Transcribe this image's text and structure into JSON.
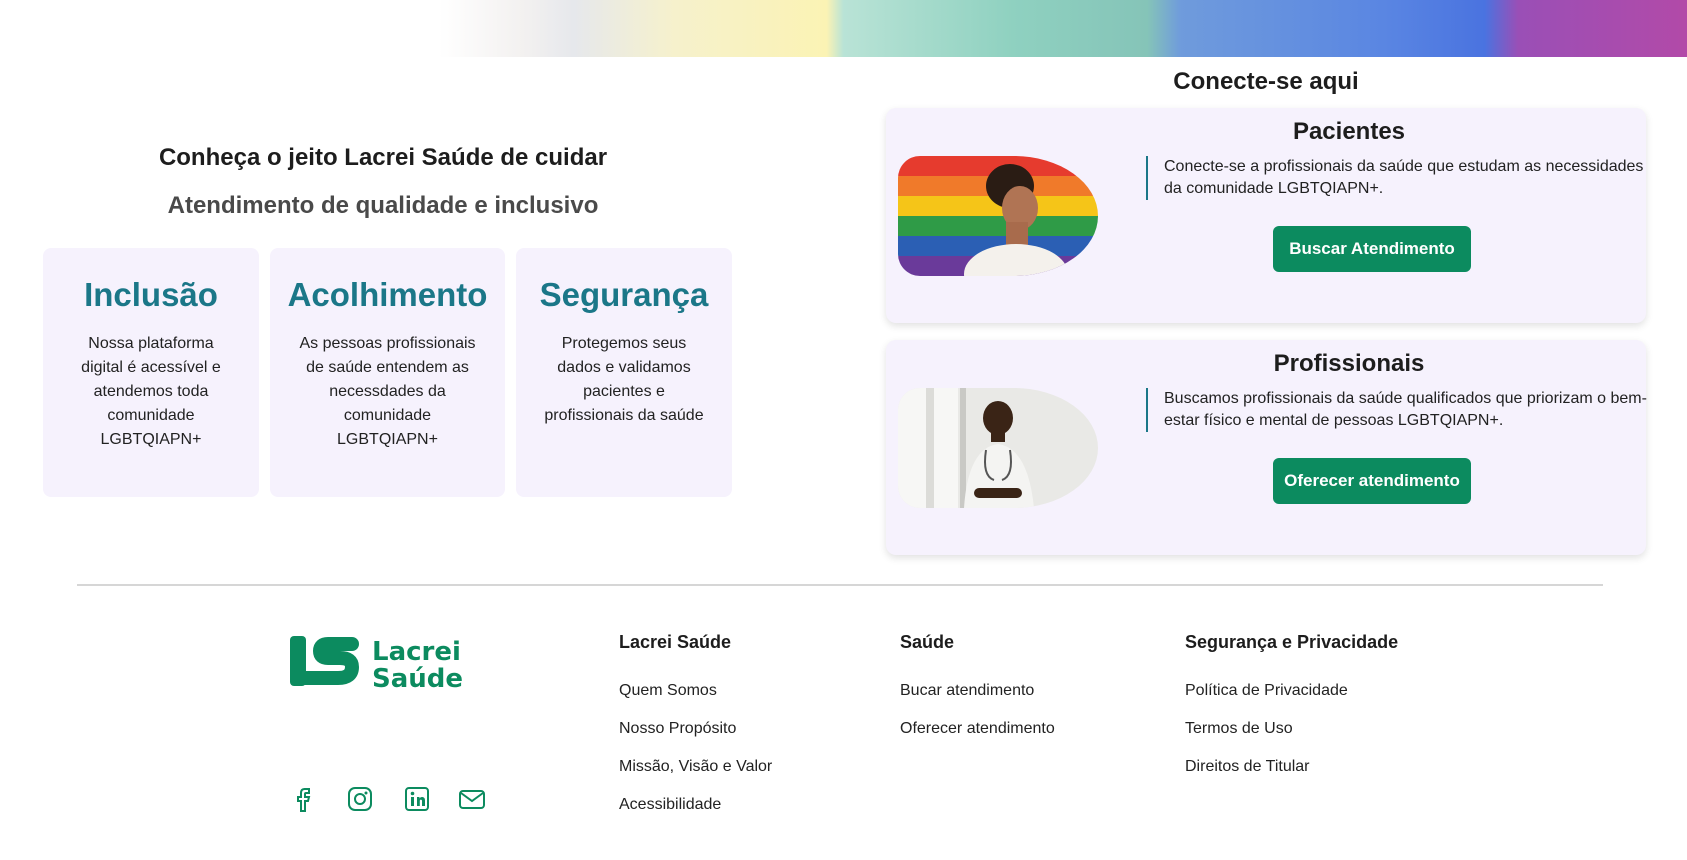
{
  "hero": {
    "title": "Conheça o jeito Lacrei Saúde de cuidar",
    "subtitle": "Atendimento de qualidade e inclusivo"
  },
  "values": [
    {
      "title": "Inclusão",
      "text": "Nossa plataforma digital é acessível e atendemos toda comunidade LGBTQIAPN+"
    },
    {
      "title": "Acolhimento",
      "text": "As pessoas profissionais de saúde entendem as necessdades da comunidade LGBTQIAPN+"
    },
    {
      "title": "Segurança",
      "text": "Protegemos seus dados e validamos pacientes e profissionais da saúde"
    }
  ],
  "connect": {
    "title": "Conecte-se aqui",
    "cards": [
      {
        "title": "Pacientes",
        "text": "Conecte-se a profissionais da saúde que estudam as necessidades da comunidade LGBTQIAPN+.",
        "button": "Buscar Atendimento"
      },
      {
        "title": "Profissionais",
        "text": "Buscamos profissionais da saúde qualificados que priorizam o bem-estar físico e mental de pessoas LGBTQIAPN+.",
        "button": "Oferecer atendimento"
      }
    ]
  },
  "footer": {
    "logo_text": [
      "Lacrei",
      "Saúde"
    ],
    "columns": [
      {
        "title": "Lacrei Saúde",
        "links": [
          "Quem Somos",
          "Nosso Propósito",
          "Missão, Visão e Valor",
          "Acessibilidade"
        ]
      },
      {
        "title": "Saúde",
        "links": [
          "Bucar atendimento",
          "Oferecer atendimento"
        ]
      },
      {
        "title": "Segurança e Privacidade",
        "links": [
          "Política de Privacidade",
          "Termos de Uso",
          "Direitos de Titular"
        ]
      }
    ],
    "social_icons": [
      "facebook-icon",
      "instagram-icon",
      "linkedin-icon",
      "email-icon"
    ]
  },
  "colors": {
    "brand_green": "#0c8b5f",
    "accent_teal": "#1b7788",
    "card_bg": "#f6f2fd"
  }
}
